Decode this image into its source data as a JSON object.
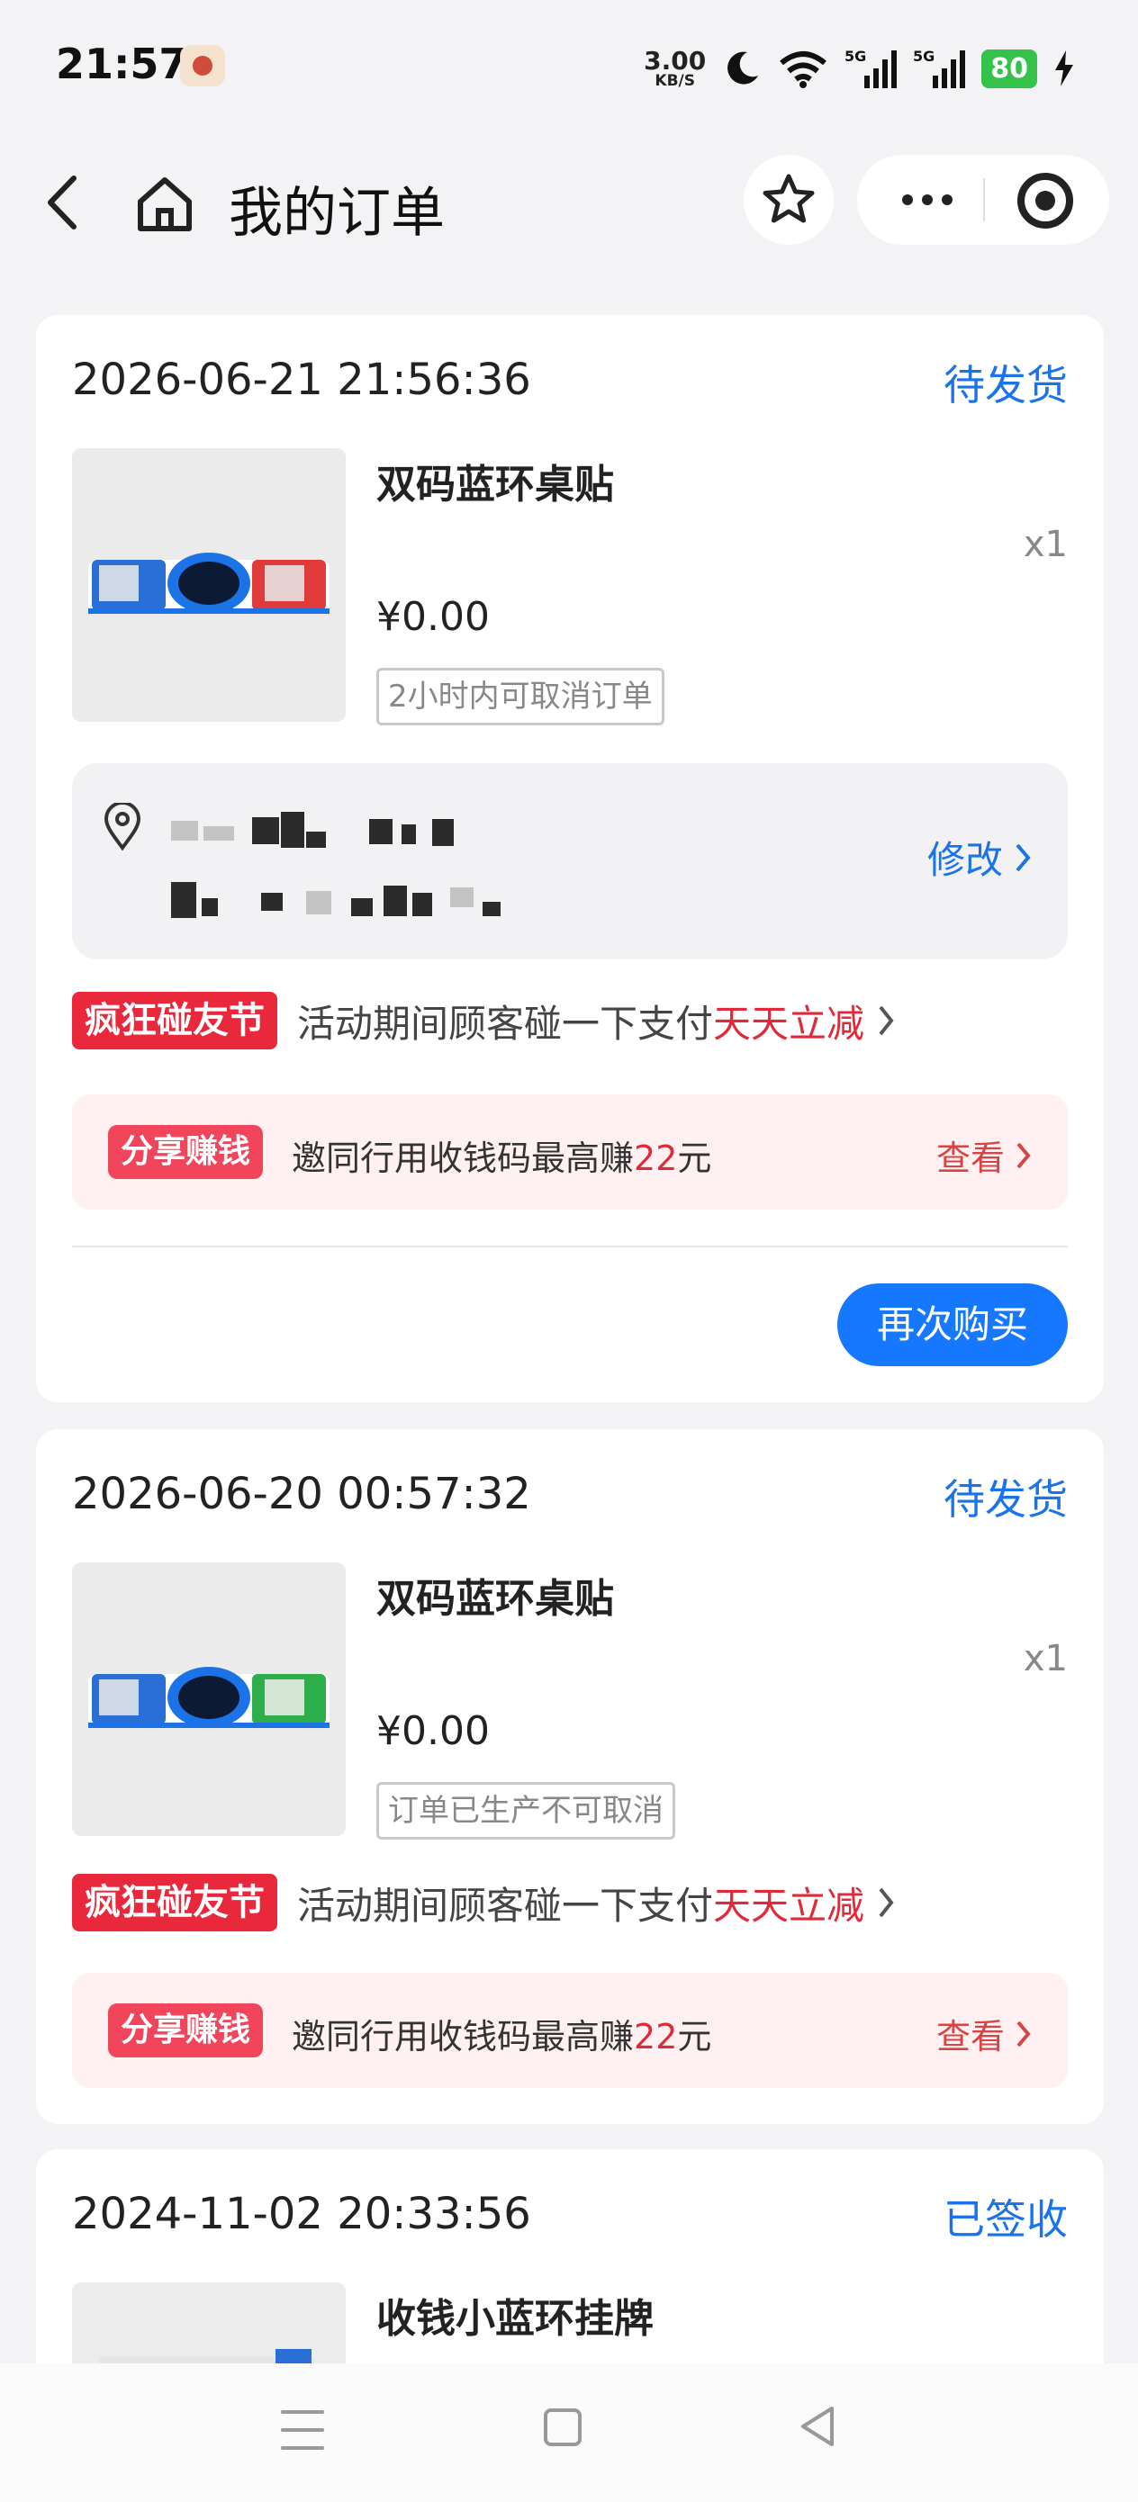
{
  "status_bar": {
    "time": "21:57",
    "net_speed_value": "3.00",
    "net_speed_unit": "KB/S",
    "battery": "80",
    "icons": [
      "moon-icon",
      "wifi-icon",
      "signal-5g-icon",
      "signal-5g-icon",
      "charging-icon"
    ]
  },
  "nav": {
    "title": "我的订单"
  },
  "orders": [
    {
      "time": "2026-06-21 21:56:36",
      "status": "待发货",
      "product": {
        "name": "双码蓝环桌贴",
        "qty": "x1",
        "price": "¥0.00",
        "tag": "2小时内可取消订单"
      },
      "address_edit": "修改",
      "promo": {
        "badge": "疯狂碰友节",
        "text": "活动期间顾客碰一下支付",
        "highlight": "天天立减"
      },
      "share": {
        "badge": "分享赚钱",
        "text": "邀同行用收钱码最高赚",
        "amount": "22",
        "unit": "元",
        "view": "查看"
      },
      "button": "再次购买"
    },
    {
      "time": "2026-06-20 00:57:32",
      "status": "待发货",
      "product": {
        "name": "双码蓝环桌贴",
        "qty": "x1",
        "price": "¥0.00",
        "tag": "订单已生产不可取消"
      },
      "promo": {
        "badge": "疯狂碰友节",
        "text": "活动期间顾客碰一下支付",
        "highlight": "天天立减"
      },
      "share": {
        "badge": "分享赚钱",
        "text": "邀同行用收钱码最高赚",
        "amount": "22",
        "unit": "元",
        "view": "查看"
      }
    },
    {
      "time": "2024-11-02 20:33:56",
      "status": "已签收",
      "product": {
        "name": "收钱小蓝环挂牌"
      }
    }
  ],
  "colors": {
    "accent_blue": "#1a73e8",
    "button_blue": "#1677ff",
    "promo_red": "#e9283c",
    "highlight_red": "#e02a3a",
    "share_bg": "#fff0f1",
    "page_bg": "#f3f3f5"
  }
}
